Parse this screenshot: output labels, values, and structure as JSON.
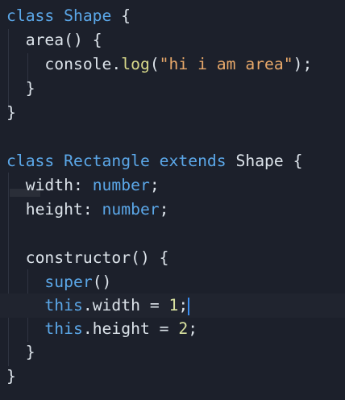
{
  "editor": {
    "colors": {
      "background": "#1c202b",
      "keyword": "#5ba7e8",
      "text": "#dce3ea",
      "string": "#e8a86a",
      "number": "#d9e2a0",
      "cursor": "#3a8df0"
    },
    "lines": [
      {
        "indent": 0,
        "tokens": [
          [
            "kw",
            "class "
          ],
          [
            "kw",
            "Shape"
          ],
          [
            "pl",
            " {"
          ]
        ]
      },
      {
        "indent": 1,
        "tokens": [
          [
            "pl",
            "area() {"
          ]
        ]
      },
      {
        "indent": 2,
        "tokens": [
          [
            "pl",
            "console."
          ],
          [
            "call",
            "log"
          ],
          [
            "pl",
            "("
          ],
          [
            "str",
            "\"hi i am area\""
          ],
          [
            "pl",
            ");"
          ]
        ]
      },
      {
        "indent": 1,
        "tokens": [
          [
            "pl",
            "}"
          ]
        ]
      },
      {
        "indent": 0,
        "tokens": [
          [
            "pl",
            "}"
          ]
        ]
      },
      {
        "indent": 0,
        "tokens": []
      },
      {
        "indent": 0,
        "tokens": [
          [
            "kw",
            "class "
          ],
          [
            "kw",
            "Rectangle "
          ],
          [
            "kw",
            "extends "
          ],
          [
            "pl",
            "Shape {"
          ]
        ]
      },
      {
        "indent": 1,
        "tokens": [
          [
            "pl",
            "width: "
          ],
          [
            "kw",
            "number"
          ],
          [
            "pl",
            ";"
          ]
        ]
      },
      {
        "indent": 1,
        "tokens": [
          [
            "pl",
            "height: "
          ],
          [
            "kw",
            "number"
          ],
          [
            "pl",
            ";"
          ]
        ]
      },
      {
        "indent": 0,
        "tokens": []
      },
      {
        "indent": 1,
        "tokens": [
          [
            "pl",
            "constructor() {"
          ]
        ]
      },
      {
        "indent": 2,
        "tokens": [
          [
            "kw",
            "super"
          ],
          [
            "pl",
            "()"
          ]
        ]
      },
      {
        "indent": 2,
        "current": true,
        "tokens": [
          [
            "kw",
            "this"
          ],
          [
            "pl",
            ".width = "
          ],
          [
            "num",
            "1"
          ],
          [
            "pl",
            ";"
          ]
        ]
      },
      {
        "indent": 2,
        "tokens": [
          [
            "kw",
            "this"
          ],
          [
            "pl",
            ".height = "
          ],
          [
            "num",
            "2"
          ],
          [
            "pl",
            ";"
          ]
        ]
      },
      {
        "indent": 1,
        "tokens": [
          [
            "pl",
            "}"
          ]
        ]
      },
      {
        "indent": 0,
        "tokens": [
          [
            "pl",
            "}"
          ]
        ]
      }
    ]
  }
}
